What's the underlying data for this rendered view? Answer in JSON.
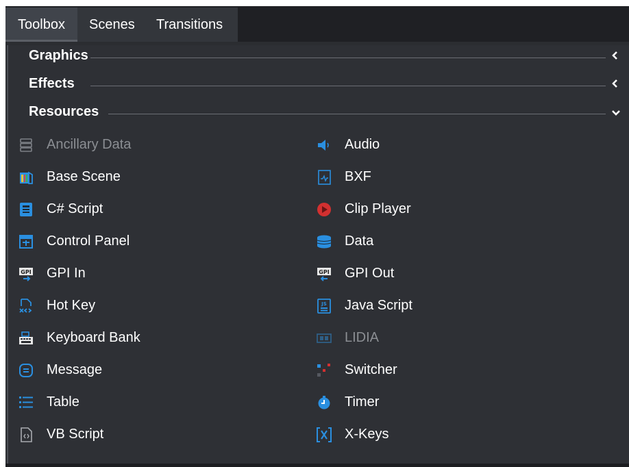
{
  "tabs": [
    {
      "label": "Toolbox",
      "active": true
    },
    {
      "label": "Scenes",
      "active": false
    },
    {
      "label": "Transitions",
      "active": false
    }
  ],
  "sections": [
    {
      "title": "Graphics",
      "state": "collapsed",
      "icon": "chevron-left-icon"
    },
    {
      "title": "Effects",
      "state": "collapsed",
      "icon": "chevron-left-icon"
    },
    {
      "title": "Resources",
      "state": "expanded",
      "icon": "chevron-down-icon"
    }
  ],
  "resources": {
    "left": [
      {
        "label": "Ancillary Data",
        "icon": "ancillary-data-icon",
        "disabled": true
      },
      {
        "label": "Base Scene",
        "icon": "base-scene-icon",
        "disabled": false
      },
      {
        "label": "C# Script",
        "icon": "csharp-script-icon",
        "disabled": false
      },
      {
        "label": "Control Panel",
        "icon": "control-panel-icon",
        "disabled": false
      },
      {
        "label": "GPI In",
        "icon": "gpi-in-icon",
        "disabled": false
      },
      {
        "label": "Hot Key",
        "icon": "hot-key-icon",
        "disabled": false
      },
      {
        "label": "Keyboard Bank",
        "icon": "keyboard-bank-icon",
        "disabled": false
      },
      {
        "label": "Message",
        "icon": "message-icon",
        "disabled": false
      },
      {
        "label": "Table",
        "icon": "table-icon",
        "disabled": false
      },
      {
        "label": "VB Script",
        "icon": "vb-script-icon",
        "disabled": false
      }
    ],
    "right": [
      {
        "label": "Audio",
        "icon": "audio-icon",
        "disabled": false
      },
      {
        "label": "BXF",
        "icon": "bxf-icon",
        "disabled": false
      },
      {
        "label": "Clip Player",
        "icon": "clip-player-icon",
        "disabled": false
      },
      {
        "label": "Data",
        "icon": "data-icon",
        "disabled": false
      },
      {
        "label": "GPI Out",
        "icon": "gpi-out-icon",
        "disabled": false
      },
      {
        "label": "Java Script",
        "icon": "java-script-icon",
        "disabled": false
      },
      {
        "label": "LIDIA",
        "icon": "lidia-icon",
        "disabled": true
      },
      {
        "label": "Switcher",
        "icon": "switcher-icon",
        "disabled": false
      },
      {
        "label": "Timer",
        "icon": "timer-icon",
        "disabled": false
      },
      {
        "label": "X-Keys",
        "icon": "x-keys-icon",
        "disabled": false
      }
    ]
  },
  "colors": {
    "background": "#2e3035",
    "tabbar": "#1f2024",
    "accent_blue": "#2a8fe0",
    "clip_red": "#d23030",
    "disabled_text": "#8b8e93"
  }
}
